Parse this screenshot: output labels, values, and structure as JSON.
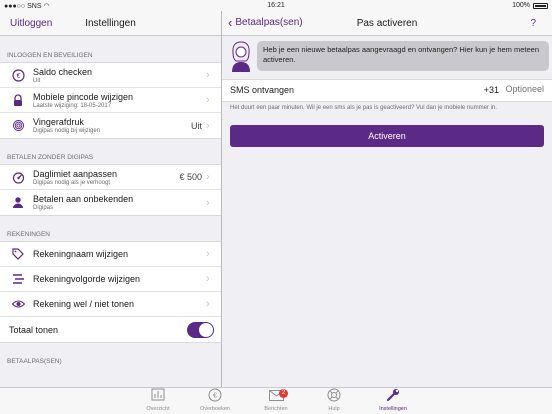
{
  "status": {
    "carrier": "SNS",
    "time": "16:21",
    "battery": "100%"
  },
  "left_nav": {
    "back_label": "Uitloggen",
    "title": "Instellingen"
  },
  "right_nav": {
    "back_label": "Betaalpas(sen)",
    "title": "Pas activeren",
    "help_label": "?"
  },
  "sections": [
    {
      "header": "INLOGGEN EN BEVEILIGEN",
      "rows": [
        {
          "title": "Saldo checken",
          "subtitle": "Uit",
          "icon": "euro-icon"
        },
        {
          "title": "Mobiele pincode wijzigen",
          "subtitle": "Laatste wijziging: 18-05-2017",
          "icon": "lock-icon"
        },
        {
          "title": "Vingerafdruk",
          "subtitle": "Digipas nodig bij wijzigen",
          "value": "Uit",
          "icon": "fingerprint-icon"
        }
      ]
    },
    {
      "header": "BETALEN ZONDER DIGIPAS",
      "rows": [
        {
          "title": "Daglimiet aanpassen",
          "subtitle": "Digipas nodig als je verhoogt",
          "value": "€ 500",
          "icon": "gauge-icon"
        },
        {
          "title": "Betalen aan onbekenden",
          "subtitle": "Digipas",
          "icon": "user-icon"
        }
      ]
    },
    {
      "header": "REKENINGEN",
      "rows": [
        {
          "title": "Rekeningnaam wijzigen",
          "icon": "tag-icon"
        },
        {
          "title": "Rekeningvolgorde wijzigen",
          "icon": "reorder-icon"
        },
        {
          "title": "Rekening wel / niet tonen",
          "icon": "eye-icon"
        },
        {
          "title": "Totaal tonen",
          "toggle": true
        }
      ]
    },
    {
      "header": "BETAALPAS(SEN)"
    }
  ],
  "activation": {
    "message": "Heb je een nieuwe betaalpas aangevraagd en ontvangen? Hier kun je hem meteen activeren.",
    "sms_label": "SMS ontvangen",
    "sms_prefix": "+31",
    "sms_placeholder": "Optioneel",
    "note": "Het duurt een paar minuten. Wil je een sms als je pas is geactiveerd? Vul dan je mobiele nummer in.",
    "button": "Activeren"
  },
  "tabs": [
    {
      "label": "Overzicht",
      "icon": "chart-icon"
    },
    {
      "label": "Overboeken",
      "icon": "euro-icon"
    },
    {
      "label": "Berichten",
      "icon": "envelope-icon",
      "badge": "2"
    },
    {
      "label": "Hulp",
      "icon": "lifebuoy-icon"
    },
    {
      "label": "Instellingen",
      "icon": "wrench-icon",
      "active": true
    }
  ]
}
